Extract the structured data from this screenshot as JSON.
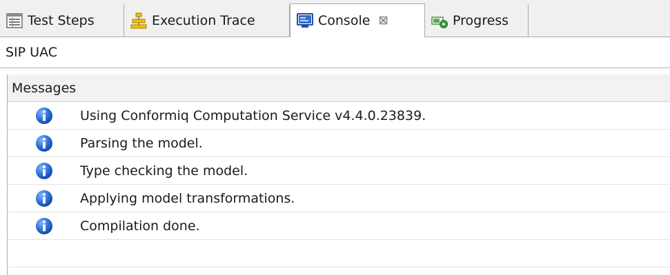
{
  "tabs": [
    {
      "label": "Test Steps",
      "icon": "test-steps-icon"
    },
    {
      "label": "Execution Trace",
      "icon": "execution-trace-icon"
    },
    {
      "label": "Console",
      "icon": "console-icon",
      "close": "⊠",
      "active": true
    },
    {
      "label": "Progress",
      "icon": "progress-icon"
    }
  ],
  "console": {
    "title": "SIP UAC"
  },
  "messages": {
    "header": "Messages",
    "rows": [
      {
        "icon": "info-icon",
        "text": "Using Conformiq Computation Service v4.4.0.23839."
      },
      {
        "icon": "info-icon",
        "text": "Parsing the model."
      },
      {
        "icon": "info-icon",
        "text": "Type checking the model."
      },
      {
        "icon": "info-icon",
        "text": "Applying model transformations."
      },
      {
        "icon": "info-icon",
        "text": "Compilation done."
      }
    ]
  },
  "colors": {
    "info_blue": "#1e5fc7",
    "tab_bar_bg": "#f0f0f0",
    "header_bg": "#f2f2f2"
  }
}
